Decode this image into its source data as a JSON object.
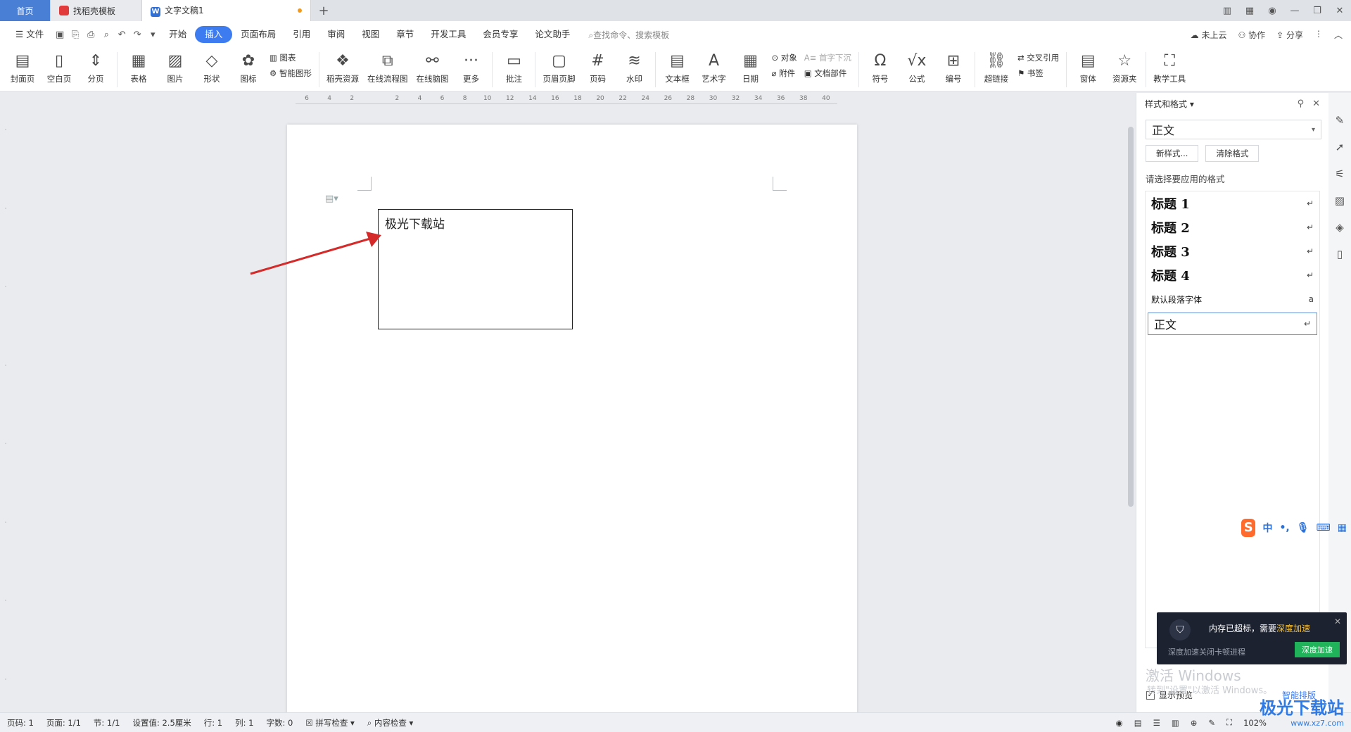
{
  "tabs": [
    {
      "label": "首页"
    },
    {
      "label": "找稻壳模板"
    },
    {
      "label": "文字文稿1"
    }
  ],
  "menu": {
    "file": "文件",
    "items": [
      "开始",
      "插入",
      "页面布局",
      "引用",
      "审阅",
      "视图",
      "章节",
      "开发工具",
      "会员专享",
      "论文助手"
    ],
    "active": "插入",
    "search": "查找命令、搜索模板",
    "right": [
      "未上云",
      "协作",
      "分享"
    ]
  },
  "ribbon": {
    "b1": "封面页",
    "b2": "空白页",
    "b3": "分页",
    "b4": "表格",
    "b5": "图片",
    "b6": "形状",
    "b7": "图标",
    "s1": "图表",
    "s2": "智能图形",
    "b8": "稻壳资源",
    "b9": "在线流程图",
    "b10": "在线脑图",
    "b11": "更多",
    "b12": "批注",
    "b13": "页眉页脚",
    "b14": "页码",
    "b15": "水印",
    "b16": "文本框",
    "b17": "艺术字",
    "b18": "日期",
    "s3": "对象",
    "s4": "附件",
    "s5": "首字下沉",
    "s6": "文档部件",
    "b19": "符号",
    "b20": "公式",
    "b21": "编号",
    "b22": "超链接",
    "s7": "交叉引用",
    "s8": "书签",
    "b23": "窗体",
    "b24": "资源夹",
    "b25": "教学工具"
  },
  "ruler": [
    "6",
    "4",
    "2",
    "",
    "2",
    "4",
    "6",
    "8",
    "10",
    "12",
    "14",
    "16",
    "18",
    "20",
    "22",
    "24",
    "26",
    "28",
    "30",
    "32",
    "34",
    "36",
    "38",
    "40"
  ],
  "document": {
    "textbox": "极光下载站"
  },
  "panel": {
    "title": "样式和格式",
    "current": "正文",
    "new_style": "新样式...",
    "clear": "清除格式",
    "choose": "请选择要应用的格式",
    "styles": [
      {
        "name": "标题 1",
        "mark": "↵"
      },
      {
        "name": "标题 2",
        "mark": "↵"
      },
      {
        "name": "标题 3",
        "mark": "↵"
      },
      {
        "name": "标题 4",
        "mark": "↵"
      },
      {
        "name": "默认段落字体",
        "mark": "a"
      },
      {
        "name": "正文",
        "mark": "↵"
      }
    ],
    "show_preview": "显示预览",
    "smart": "智能排版"
  },
  "ime": {
    "lang": "中"
  },
  "toast": {
    "msg": "内存已超标，需要",
    "accent": "深度加速",
    "sub": "深度加速关闭卡顿进程",
    "button": "深度加速"
  },
  "watermark": {
    "line1": "激活 Windows",
    "line2": "转到\"设置\"以激活 Windows。"
  },
  "status": {
    "page": "页码: 1",
    "pages": "页面: 1/1",
    "section": "节: 1/1",
    "setting": "设置值: 2.5厘米",
    "row": "行: 1",
    "col": "列: 1",
    "words": "字数: 0",
    "spell": "拼写检查",
    "content": "内容检查",
    "zoom": "102%"
  },
  "brand": {
    "name": "极光下载站",
    "url": "www.xz7.com"
  },
  "colors": {
    "accent": "#3d7cf0",
    "tab_home": "#4a7fd6",
    "arrow": "#d42a2a"
  }
}
